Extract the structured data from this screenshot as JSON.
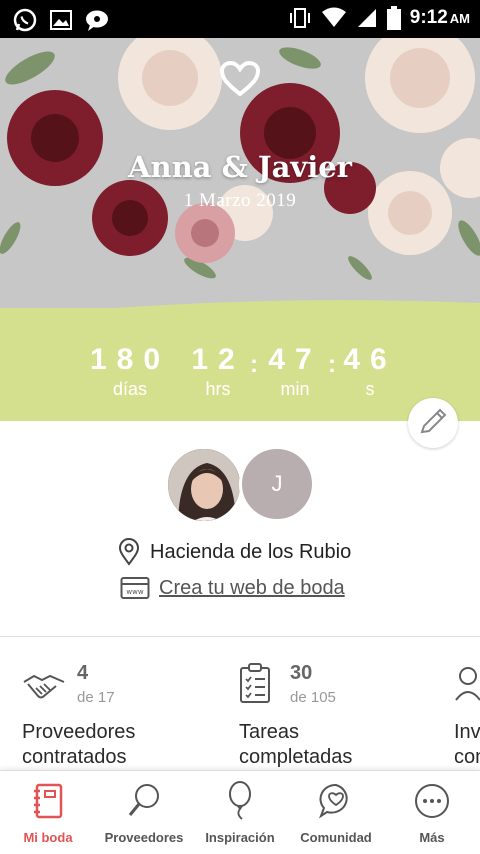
{
  "status_bar": {
    "time": "9:12",
    "ampm": "AM"
  },
  "hero": {
    "couple": "Anna & Javier",
    "date": "1 Marzo 2019",
    "countdown": {
      "days": "180",
      "days_label": "días",
      "hours": "12",
      "hours_label": "hrs",
      "minutes": "47",
      "minutes_label": "min",
      "seconds": "46",
      "seconds_label": "s"
    }
  },
  "profile": {
    "partner_initial": "J",
    "venue": "Hacienda de los Rubio",
    "web_link": "Crea tu web de boda"
  },
  "stats": [
    {
      "value": "4",
      "of": "de 17",
      "title_line1": "Proveedores",
      "title_line2": "contratados"
    },
    {
      "value": "30",
      "of": "de 105",
      "title_line1": "Tareas",
      "title_line2": "completadas"
    },
    {
      "value": "",
      "of": "",
      "title_line1": "Inv",
      "title_line2": "con"
    }
  ],
  "nav": [
    {
      "label": "Mi boda",
      "icon": "notebook-icon",
      "active": true
    },
    {
      "label": "Proveedores",
      "icon": "magnifier-icon"
    },
    {
      "label": "Inspiración",
      "icon": "balloon-icon"
    },
    {
      "label": "Comunidad",
      "icon": "chat-heart-icon"
    },
    {
      "label": "Más",
      "icon": "more-dots-icon"
    }
  ],
  "colors": {
    "accent": "#e25354",
    "green_band": "#d5e08e",
    "hero_bg": "#c7c7c7"
  }
}
